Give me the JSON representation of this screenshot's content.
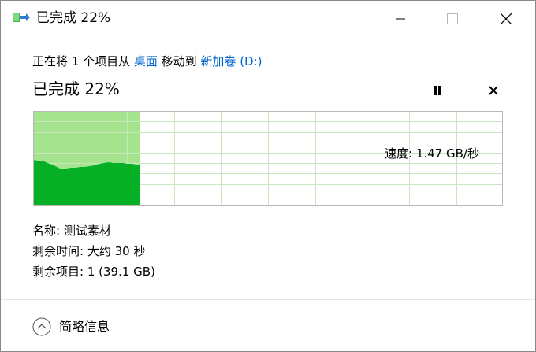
{
  "window": {
    "title": "已完成 22%",
    "icon": "file-move-icon"
  },
  "titlebar_buttons": {
    "minimize": "minimize-icon",
    "maximize": "maximize-icon",
    "close": "close-icon"
  },
  "move_line": {
    "prefix": "正在将 1 个项目从 ",
    "source": "桌面",
    "middle": " 移动到 ",
    "destination": "新加卷 (D:)"
  },
  "progress": {
    "title": "已完成 22%",
    "percent": 22,
    "pause_icon": "pause-icon",
    "cancel_icon": "close-icon"
  },
  "speed": {
    "label": "速度: 1.47 GB/秒"
  },
  "details": {
    "name": "名称: 测试素材",
    "time_remaining": "剩余时间: 大约 30 秒",
    "items_remaining": "剩余项目: 1 (39.1 GB)"
  },
  "footer": {
    "toggle_label": "简略信息",
    "toggle_icon": "chevron-up-circle-icon"
  },
  "colors": {
    "graph_light": "#a6e38f",
    "graph_dark": "#06b025",
    "grid": "#c7e8bd",
    "link": "#0066cc"
  }
}
